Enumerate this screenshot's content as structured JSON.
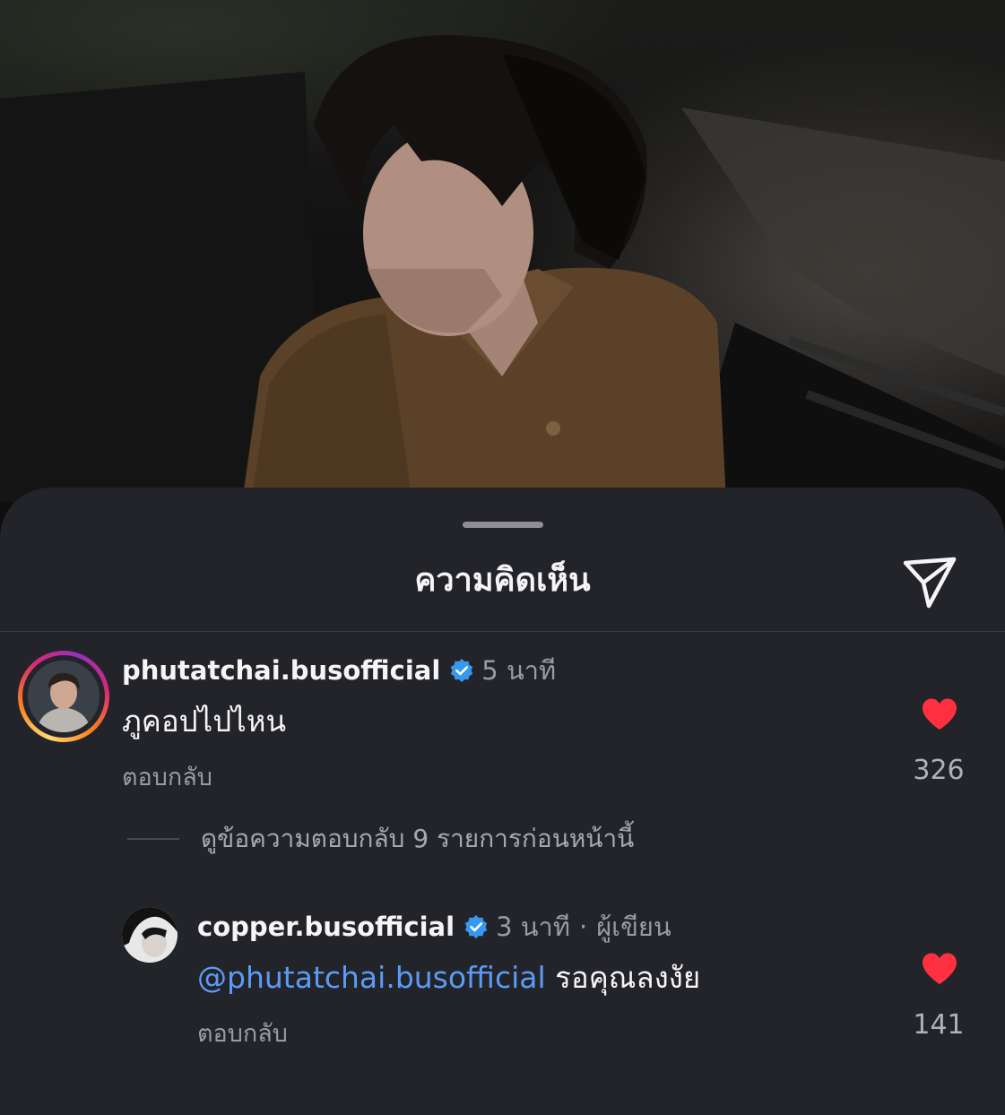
{
  "sheet": {
    "title": "ความคิดเห็น",
    "share_icon": "paper-plane-icon"
  },
  "comments": [
    {
      "username": "phutatchai.busofficial",
      "verified": true,
      "time": "5 นาที",
      "text": "ภูคอปไปไหน",
      "reply_label": "ตอบกลับ",
      "likes": "326",
      "liked": true,
      "avatar_story_ring": true
    }
  ],
  "view_replies": {
    "label": "ดูข้อความตอบกลับ 9 รายการก่อนหน้านี้"
  },
  "replies": [
    {
      "username": "copper.busofficial",
      "verified": true,
      "time": "3 นาที",
      "separator": "·",
      "author_badge": "ผู้เขียน",
      "mention": "@phutatchai.busofficial",
      "text": "รอคุณลงงัย",
      "reply_label": "ตอบกลับ",
      "likes": "141",
      "liked": true
    }
  ],
  "colors": {
    "sheet_bg": "#232429",
    "like_red": "#ff3040",
    "verified_blue": "#3897f0",
    "mention_blue": "#5b9bf6"
  }
}
